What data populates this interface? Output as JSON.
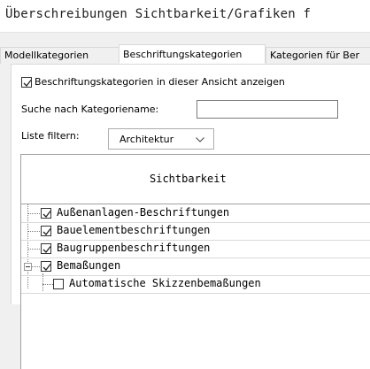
{
  "window": {
    "title": "Überschreibungen Sichtbarkeit/Grafiken f"
  },
  "tabs": [
    {
      "label": "Modellkategorien",
      "active": false
    },
    {
      "label": "Beschriftungskategorien",
      "active": true
    },
    {
      "label": "Kategorien für Ber",
      "active": false
    }
  ],
  "options": {
    "show_annotations_label": "Beschriftungskategorien in dieser Ansicht anzeigen",
    "show_annotations_checked": true,
    "search_label": "Suche nach Kategoriename:",
    "search_value": "",
    "filter_label": "Liste filtern:",
    "filter_value": "Architektur"
  },
  "grid": {
    "header": "Sichtbarkeit",
    "rows": [
      {
        "label": "Außenanlagen-Beschriftungen",
        "checked": true
      },
      {
        "label": "Bauelementbeschriftungen",
        "checked": true
      },
      {
        "label": "Baugruppenbeschriftungen",
        "checked": true
      },
      {
        "label": "Bemaßungen",
        "checked": true,
        "expanded": true
      },
      {
        "label": "Automatische Skizzenbemaßungen",
        "checked": false,
        "child": true
      }
    ]
  },
  "icons": {
    "check": "checkmark-icon",
    "dropdown": "chevron-down-icon",
    "collapse": "collapse-icon"
  },
  "colors": {
    "border": "#a0a0a0",
    "tab_border": "#d9d9d9",
    "background": "#f0f0f0"
  }
}
